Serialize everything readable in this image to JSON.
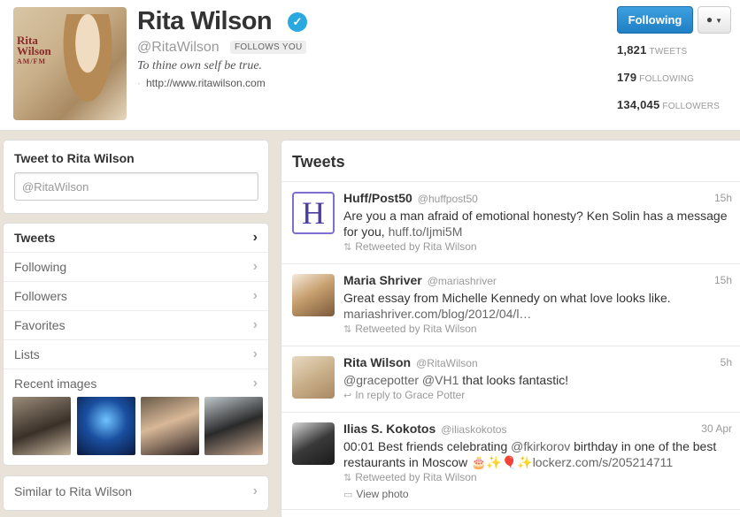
{
  "profile": {
    "name": "Rita Wilson",
    "handle": "@RitaWilson",
    "follows_you": "FOLLOWS YOU",
    "bio": "To thine own self be true.",
    "website": "http://www.ritawilson.com",
    "avatar_logo_line1": "Rita",
    "avatar_logo_line2": "Wilson",
    "avatar_logo_line3": "AM/FM"
  },
  "actions": {
    "following_label": "Following",
    "user_menu_icon": "user-icon"
  },
  "stats": {
    "tweets_count": "1,821",
    "tweets_label": "TWEETS",
    "following_count": "179",
    "following_label": "FOLLOWING",
    "followers_count": "134,045",
    "followers_label": "FOLLOWERS"
  },
  "tweet_to": {
    "title": "Tweet to Rita Wilson",
    "placeholder": "@RitaWilson"
  },
  "nav": {
    "items": [
      {
        "label": "Tweets"
      },
      {
        "label": "Following"
      },
      {
        "label": "Followers"
      },
      {
        "label": "Favorites"
      },
      {
        "label": "Lists"
      },
      {
        "label": "Recent images"
      }
    ]
  },
  "similar": {
    "label": "Similar to Rita Wilson"
  },
  "timeline": {
    "title": "Tweets",
    "tweets": [
      {
        "name": "Huff/Post50",
        "handle": "@huffpost50",
        "time": "15h",
        "text": "Are you a man afraid of emotional honesty? Ken Solin has a message for you,",
        "link": "huff.to/Ijmi5M",
        "meta": "Retweeted by Rita Wilson",
        "avatar_letter": "H"
      },
      {
        "name": "Maria Shriver",
        "handle": "@mariashriver",
        "time": "15h",
        "text": "Great essay from Michelle Kennedy on what love looks like.",
        "link": "mariashriver.com/blog/2012/04/l…",
        "meta": "Retweeted by Rita Wilson"
      },
      {
        "name": "Rita Wilson",
        "handle": "@RitaWilson",
        "time": "5h",
        "text_prefix": "@gracepotter @VH1",
        "text": "that looks fantastic!",
        "meta": "In reply to Grace Potter"
      },
      {
        "name": "Ilias S. Kokotos",
        "handle": "@iliaskokotos",
        "time": "30 Apr",
        "text": "00:01 Best friends celebrating",
        "mention": "@fkirkorov",
        "text2": "birthday in one of the best restaurants in Moscow",
        "emoji": "🎂✨🎈✨",
        "link": "lockerz.com/s/205214711",
        "meta": "Retweeted by Rita Wilson",
        "meta2": "View photo"
      }
    ]
  },
  "colors": {
    "accent": "#2aa9e0",
    "button_blue": "#1f7fc4",
    "background": "#e8e2d8"
  }
}
